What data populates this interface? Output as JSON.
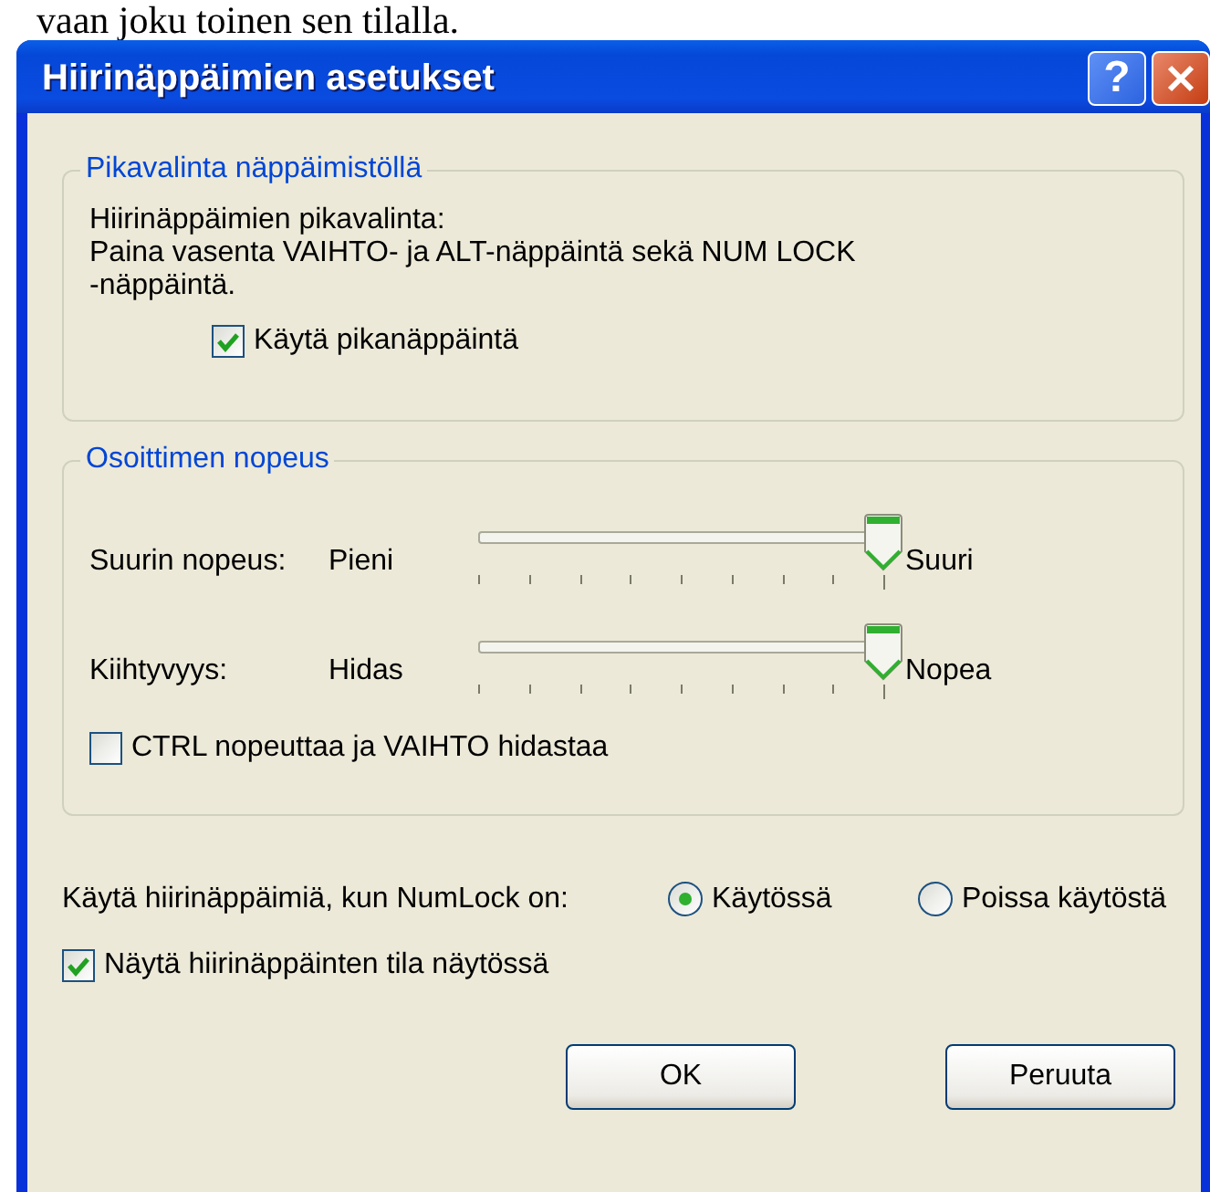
{
  "page_text": "vaan joku toinen sen tilalla.",
  "window": {
    "title": "Hiirinäppäimien asetukset",
    "help_button": "?"
  },
  "shortcut_group": {
    "title": "Pikavalinta näppäimistöllä",
    "description": "Hiirinäppäimien pikavalinta:\nPaina vasenta VAIHTO- ja ALT-näppäintä sekä NUM LOCK\n-näppäintä.",
    "checkbox": {
      "label": "Käytä pikanäppäintä",
      "checked": true
    }
  },
  "speed_group": {
    "title": "Osoittimen nopeus",
    "sliders": [
      {
        "label": "Suurin nopeus:",
        "min_label": "Pieni",
        "max_label": "Suuri"
      },
      {
        "label": "Kiihtyvyys:",
        "min_label": "Hidas",
        "max_label": "Nopea"
      }
    ],
    "checkbox": {
      "label": "CTRL nopeuttaa ja VAIHTO hidastaa",
      "checked": false
    }
  },
  "numlock": {
    "label": "Käytä hiirinäppäimiä, kun NumLock on:",
    "options": [
      {
        "label": "Käytössä",
        "selected": true
      },
      {
        "label": "Poissa käytöstä",
        "selected": false
      }
    ]
  },
  "status_checkbox": {
    "label": "Näytä hiirinäppäinten tila näytössä",
    "checked": true
  },
  "buttons": [
    {
      "label": "OK"
    },
    {
      "label": "Peruuta"
    }
  ]
}
